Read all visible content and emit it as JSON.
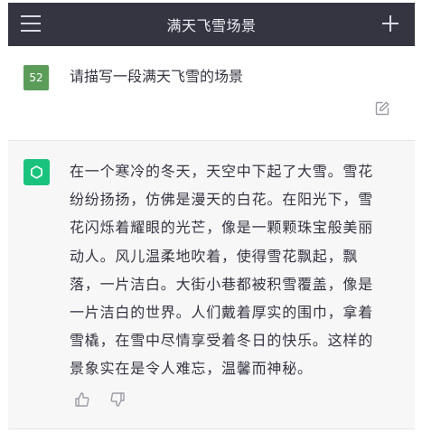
{
  "header": {
    "title": "满天飞雪场景",
    "menu_icon": "menu-icon",
    "new_chat_icon": "plus-icon"
  },
  "conversation": {
    "user_message": {
      "avatar_label": "52",
      "text": "请描写一段满天飞雪的场景",
      "edit_icon": "edit-icon"
    },
    "assistant_message": {
      "avatar_icon": "chatgpt-logo-icon",
      "lines": [
        "在一个寒冷的冬天，天空中下起了大雪。雪花",
        "纷纷扬扬，仿佛是漫天的白花。在阳光下，雪",
        "花闪烁着耀眼的光芒，像是一颗颗珠宝般美丽",
        "动人。风儿温柔地吹着，使得雪花飘起，飘",
        "落，一片洁白。大街小巷都被积雪覆盖，像是",
        "一片洁白的世界。人们戴着厚实的围巾，拿着",
        "雪橇，在雪中尽情享受着冬日的快乐。这样的",
        "景象实在是令人难忘，温馨而神秘。"
      ],
      "feedback_icons": [
        "thumbs-up-icon",
        "thumbs-down-icon"
      ]
    }
  },
  "colors": {
    "topbar_bg": "#343541",
    "user_avatar_bg": "#5b9c58",
    "assistant_avatar_bg": "#19c37d",
    "assistant_bg": "#f7f7f8",
    "text": "#343541"
  }
}
